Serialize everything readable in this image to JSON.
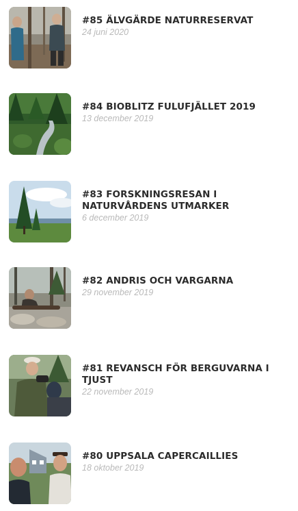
{
  "episodes": [
    {
      "title": "#85 ÄLVGÄRDE NATURRESERVAT",
      "date": "24 juni 2020",
      "thumb_icon": "forest-people-photo"
    },
    {
      "title": "#84 BIOBLITZ FULUFJÄLLET 2019",
      "date": "13 december 2019",
      "thumb_icon": "forest-stream-photo"
    },
    {
      "title": "#83 FORSKNINGSRESAN I NATURVÅRDENS UTMARKER",
      "date": "6 december 2019",
      "thumb_icon": "spruce-landscape-photo"
    },
    {
      "title": "#82 ANDRIS OCH VARGARNA",
      "date": "29 november 2019",
      "thumb_icon": "forest-rocks-photo"
    },
    {
      "title": "#81 REVANSCH FÖR BERGUVARNA I TJUST",
      "date": "22 november 2019",
      "thumb_icon": "man-binoculars-photo"
    },
    {
      "title": "#80 UPPSALA CAPERCAILLIES",
      "date": "18 oktober 2019",
      "thumb_icon": "selfie-house-photo"
    }
  ]
}
